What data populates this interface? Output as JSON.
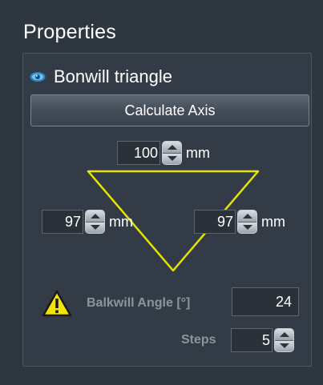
{
  "panel": {
    "title": "Properties"
  },
  "group": {
    "label": "Bonwill triangle"
  },
  "calculate_button": {
    "label": "Calculate Axis"
  },
  "fields": {
    "top": {
      "value": "100",
      "unit": "mm"
    },
    "left": {
      "value": "97",
      "unit": "mm"
    },
    "right": {
      "value": "97",
      "unit": "mm"
    }
  },
  "balkwill": {
    "label": "Balkwill Angle [°]",
    "value": "24"
  },
  "steps": {
    "label": "Steps",
    "value": "5"
  },
  "colors": {
    "triangle": "#e5e500",
    "warning": "#f2e600",
    "eye": "#3aa0e0"
  },
  "icons": {
    "visibility": "eye-icon",
    "warning": "warning-icon"
  }
}
